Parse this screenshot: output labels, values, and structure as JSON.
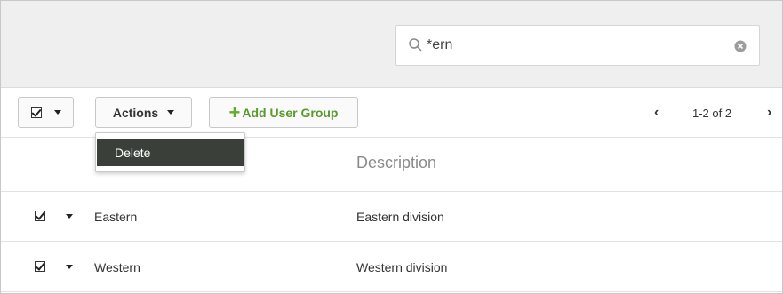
{
  "search": {
    "value": "*ern",
    "icon": "search-icon",
    "clear_icon": "clear-icon"
  },
  "toolbar": {
    "actions_label": "Actions",
    "add_label": "Add User Group",
    "add_icon": "plus-icon",
    "accent_color": "#5fae26"
  },
  "dropdown": {
    "items": [
      {
        "label": "Delete"
      }
    ]
  },
  "pager": {
    "prev": "‹",
    "text": "1-2 of 2",
    "next": "›"
  },
  "table": {
    "columns": [
      "",
      "",
      "Description"
    ],
    "rows": [
      {
        "name": "Eastern",
        "description": "Eastern division",
        "checked": true
      },
      {
        "name": "Western",
        "description": "Western division",
        "checked": true
      }
    ]
  }
}
